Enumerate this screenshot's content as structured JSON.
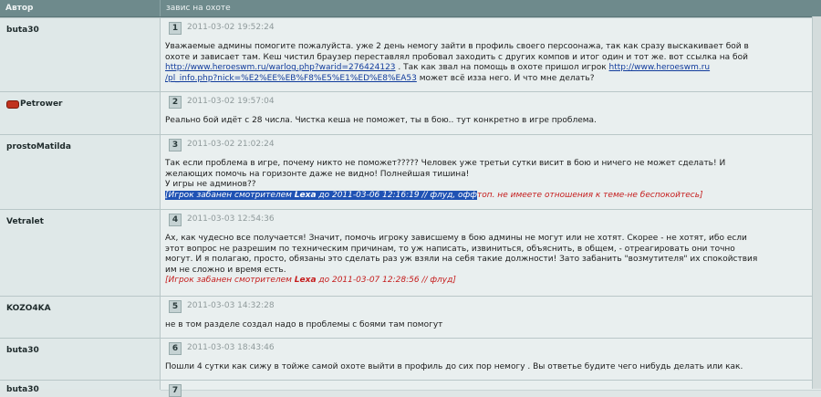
{
  "header": {
    "author_col": "Автор",
    "topic": "завис на охоте"
  },
  "posts": [
    {
      "author": "buta30",
      "num": "1",
      "date": "2011-03-02 19:52:24",
      "text1": "Уважаемые админы помогите пожалуйста. уже 2 день немогу зайти в профиль своего персоонажа, так как сразу выскакивает бой в",
      "text2": "охоте и зависает там. Кеш чистил браузер переставлял пробовал заходить с других компов и итог один и тот же. вот ссылка на бой",
      "link1": "http://www.heroeswm.ru/warlog.php?warid=276424123",
      "text3": ". Так как звал на помощь в охоте пришол игрок",
      "link2a": "http://www.heroeswm.ru",
      "link2b": "/pl_info.php?nick=%E2%EE%EB%F8%E5%E1%ED%E8%EA53",
      "text4": "может всё изза него. И что мне делать?"
    },
    {
      "author": "Petrower",
      "num": "2",
      "date": "2011-03-02 19:57:04",
      "text1": "Реально бой идёт с 28 числа. Чистка кеша не поможет, ты в бою.. тут конкретно в игре проблема."
    },
    {
      "author": "prostoMatilda",
      "num": "3",
      "date": "2011-03-02 21:02:24",
      "text1": "Так если проблема в игре, почему никто не поможет????? Человек уже третьи сутки висит в бою и ничего не может сделать! И",
      "text2": "желающих помочь на горизонте даже не видно! Полнейшая тишина!",
      "text3": "У игры не админов??",
      "ban_pre": "[Игрок забанен смотрителем ",
      "ban_name": "Lexa",
      "ban_mid": " до 2011-03-06 12:16:19 // флуд, офф",
      "ban_post": "топ. не имеете отношения к теме-не беспокойтесь]"
    },
    {
      "author": "Vetralet",
      "num": "4",
      "date": "2011-03-03 12:54:36",
      "text1": "Ах, как чудесно все получается! Значит, помочь игроку зависшему в бою админы не могут или не хотят. Скорее - не хотят, ибо если",
      "text2": "этот вопрос не разрешим по техническим причинам, то уж написать, извиниться, объяснить, в общем, - отреагировать они точно",
      "text3": "могут. И я полагаю, просто, обязаны это сделать раз уж взяли на себя такие должности! Зато забанить \"возмутителя\" их спокойствия",
      "text4": "им не сложно и время есть.",
      "ban_pre": "[Игрок забанен смотрителем ",
      "ban_name": "Lexa",
      "ban_post": " до 2011-03-07 12:28:56 // флуд]"
    },
    {
      "author": "KOZO4KA",
      "num": "5",
      "date": "2011-03-03 14:32:28",
      "text1": "не в том разделе создал надо в проблемы с боями там помогут"
    },
    {
      "author": "buta30",
      "num": "6",
      "date": "2011-03-03 18:43:46",
      "text1": "Пошли 4 сутки как сижу в тойже самой охоте выйти в профиль до сих пор немогу . Вы ответье будите чего нибудь делать или как."
    },
    {
      "author": "buta30",
      "num": "7",
      "date": ""
    }
  ]
}
